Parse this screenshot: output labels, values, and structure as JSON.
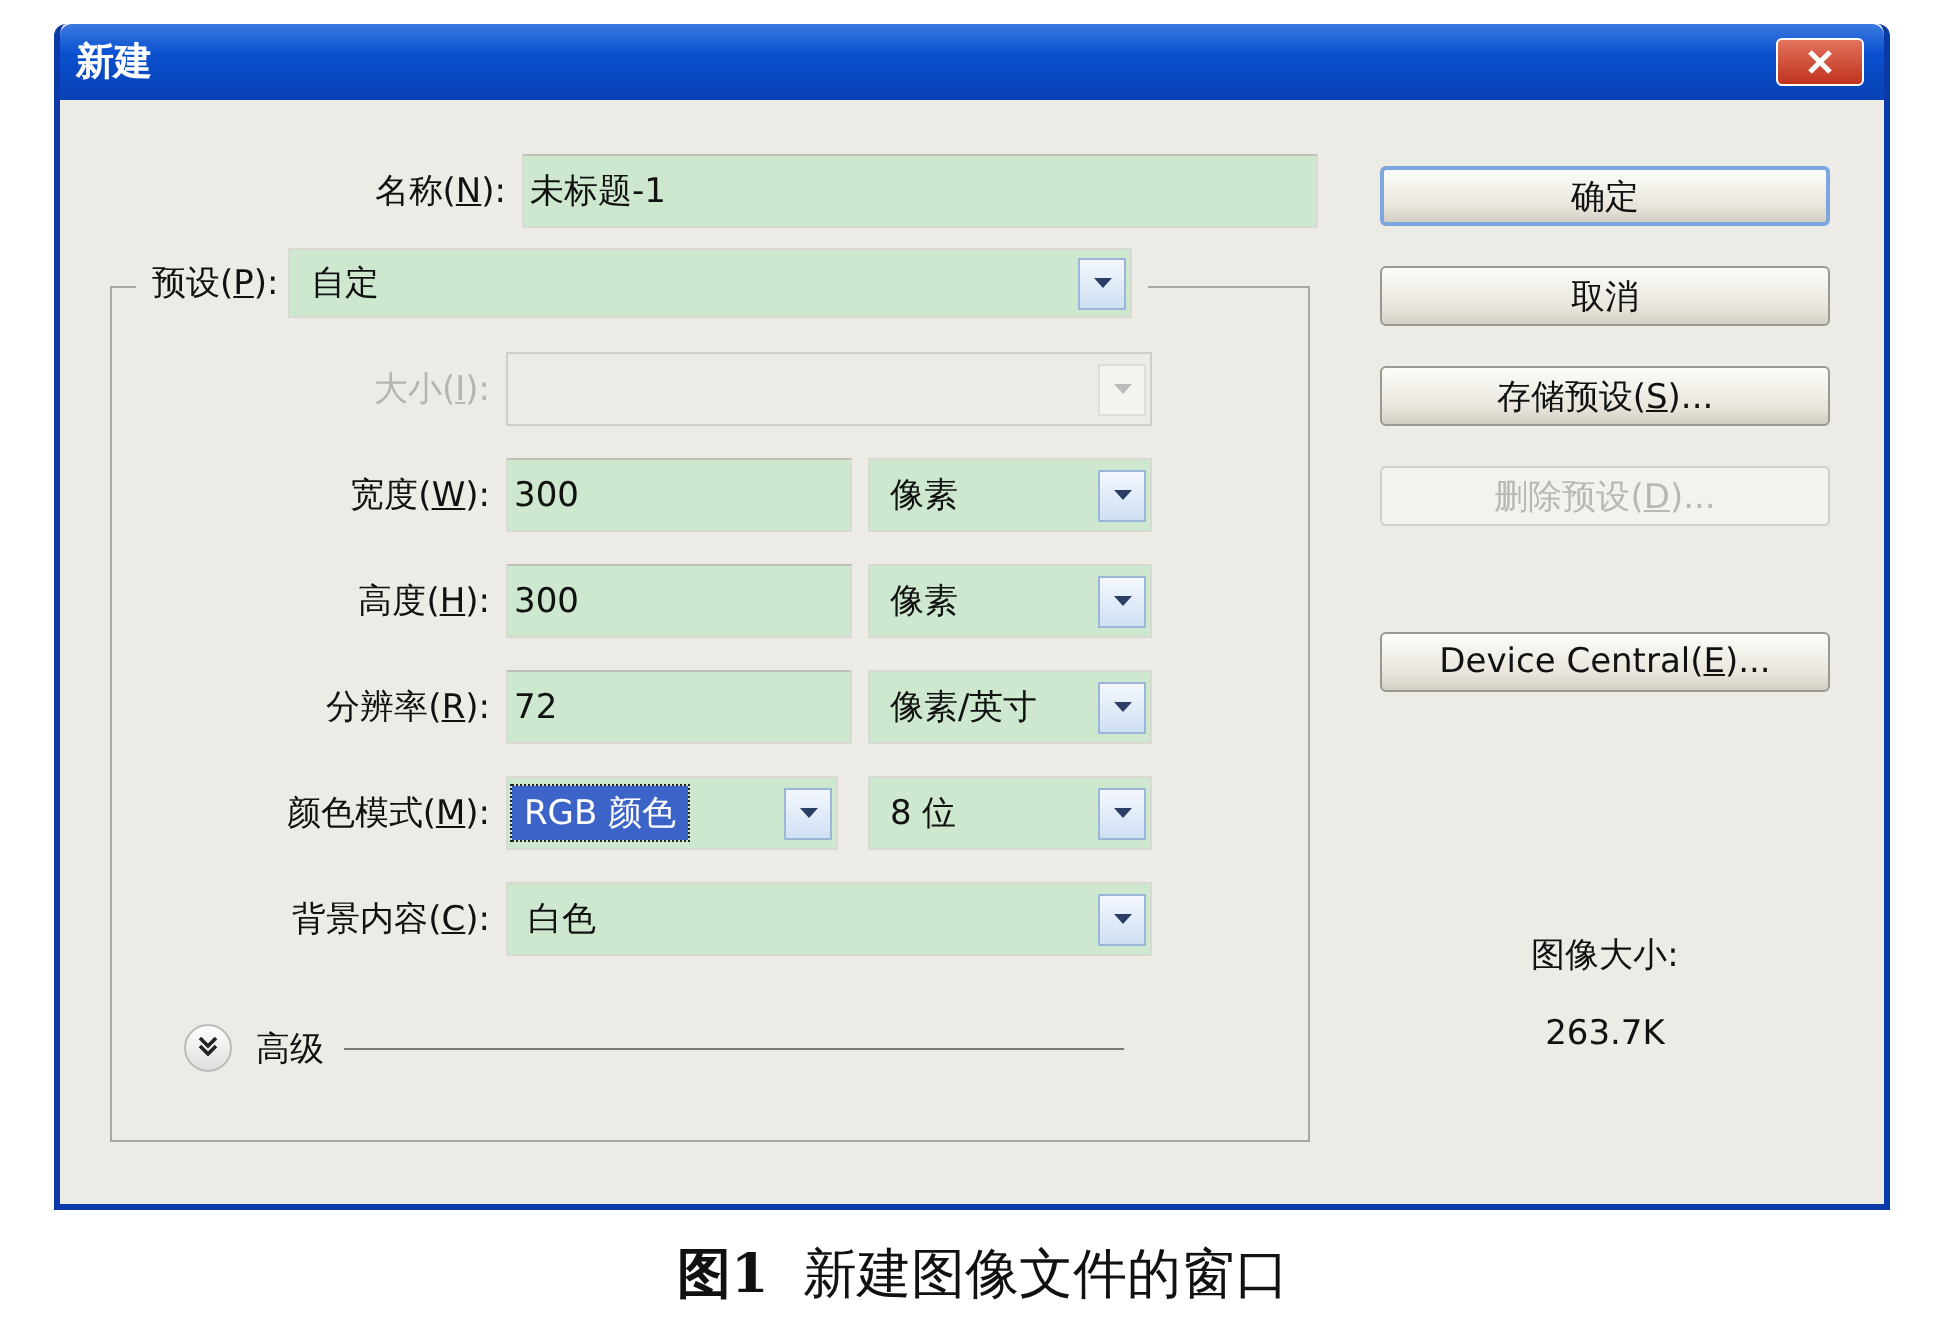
{
  "window": {
    "title": "新建"
  },
  "name_field": {
    "label_parts": [
      "名称(",
      "N",
      "):"
    ],
    "value": "未标题-1"
  },
  "preset": {
    "label_parts": [
      "预设(",
      "P",
      "):"
    ],
    "value": "自定"
  },
  "rows": [
    {
      "kind": "combo",
      "label_parts": [
        "大小(",
        "I",
        "):"
      ],
      "disabled": true
    },
    {
      "kind": "field_combo",
      "label_parts": [
        "宽度(",
        "W",
        "):"
      ],
      "disabled": false,
      "value": "300",
      "unit": "像素"
    },
    {
      "kind": "field_combo",
      "label_parts": [
        "高度(",
        "H",
        "):"
      ],
      "disabled": false,
      "value": "300",
      "unit": "像素"
    },
    {
      "kind": "field_combo",
      "label_parts": [
        "分辨率(",
        "R",
        "):"
      ],
      "disabled": false,
      "value": "72",
      "unit": "像素/英寸"
    },
    {
      "kind": "combo_combo",
      "label_parts": [
        "颜色模式(",
        "M",
        "):"
      ],
      "disabled": false,
      "value": "RGB 颜色",
      "highlighted": true,
      "unit": "8 位"
    },
    {
      "kind": "combo",
      "label_parts": [
        "背景内容(",
        "C",
        "):"
      ],
      "disabled": false,
      "value": "白色"
    }
  ],
  "advanced": {
    "label": "高级",
    "expanded": false
  },
  "buttons": [
    {
      "label_parts": [
        "确定"
      ],
      "default": true,
      "disabled": false
    },
    {
      "label_parts": [
        "取消"
      ],
      "default": false,
      "disabled": false
    },
    {
      "label_parts": [
        "存储预设(",
        "S",
        ")..."
      ],
      "default": false,
      "disabled": false
    },
    {
      "label_parts": [
        "删除预设(",
        "D",
        ")..."
      ],
      "default": false,
      "disabled": true
    },
    {
      "label_parts": [
        "Device Central(",
        "E",
        ")..."
      ],
      "default": false,
      "disabled": false
    }
  ],
  "image_size": {
    "label": "图像大小:",
    "value": "263.7K"
  },
  "caption": "**图1**  新建图像文件的窗口"
}
